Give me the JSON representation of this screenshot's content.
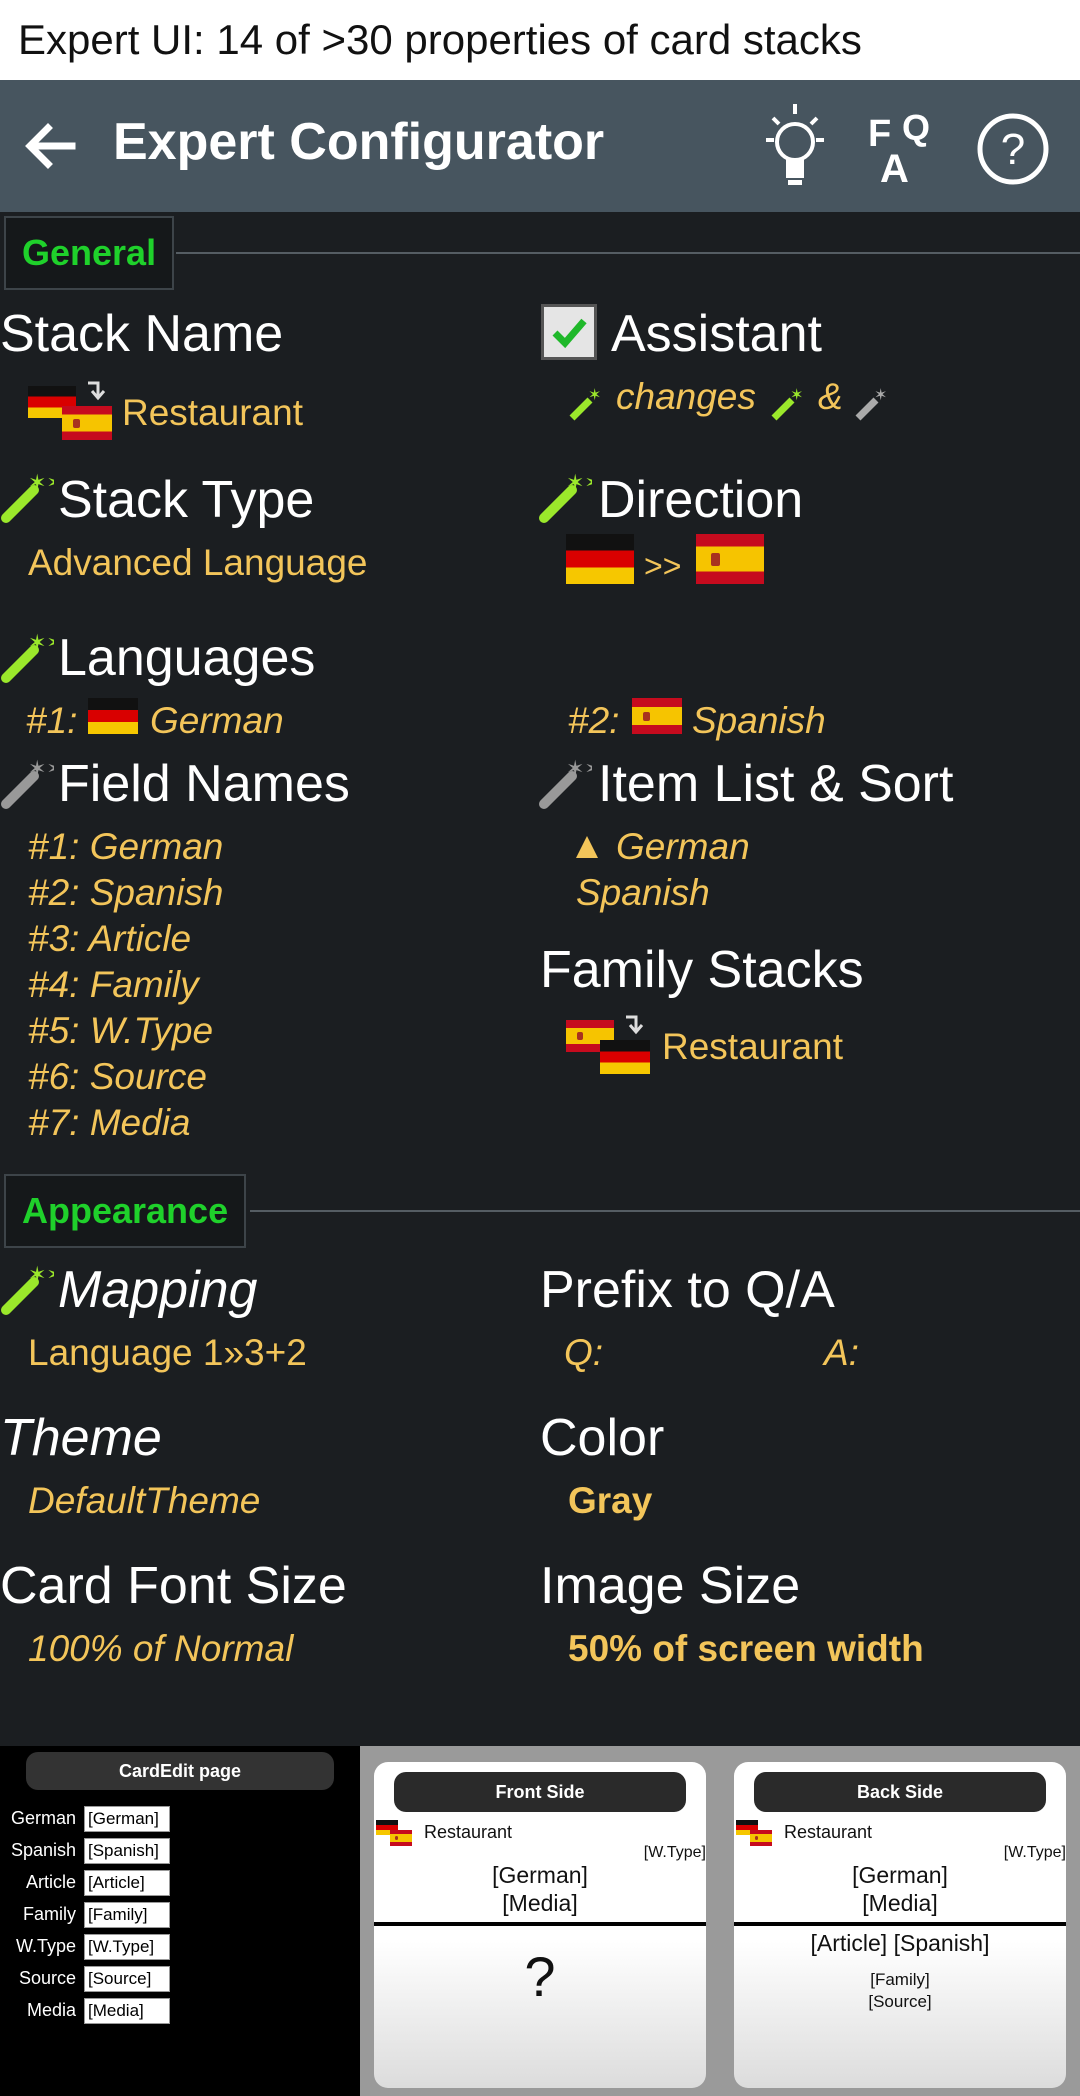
{
  "caption": "Expert UI: 14 of >30 properties of card stacks",
  "appbar": {
    "title": "Expert Configurator",
    "back_icon": "arrow-left-icon",
    "icons": [
      "lightbulb-icon",
      "faq-icon",
      "help-icon"
    ]
  },
  "general": {
    "header": "General",
    "stack_name": {
      "label": "Stack Name",
      "value": "Restaurant"
    },
    "assistant": {
      "label": "Assistant",
      "checked": true,
      "value_a": "changes",
      "value_b": "&"
    },
    "stack_type": {
      "label": "Stack Type",
      "value": "Advanced Language"
    },
    "direction": {
      "label": "Direction",
      "sep": ">>"
    },
    "languages": {
      "label": "Languages",
      "lang1_prefix": "#1:",
      "lang1": "German",
      "lang2_prefix": "#2:",
      "lang2": "Spanish"
    },
    "field_names": {
      "label": "Field Names",
      "items": [
        "#1: German",
        "#2: Spanish",
        "#3: Article",
        "#4: Family",
        "#5: W.Type",
        "#6: Source",
        "#7: Media"
      ]
    },
    "item_list": {
      "label": "Item List & Sort",
      "items": [
        "German",
        "Spanish"
      ]
    },
    "family_stacks": {
      "label": "Family Stacks",
      "value": "Restaurant"
    }
  },
  "appearance": {
    "header": "Appearance",
    "mapping": {
      "label": "Mapping",
      "value": "Language 1»3+2"
    },
    "prefix": {
      "label": "Prefix to Q/A",
      "q": "Q:",
      "a": "A:"
    },
    "theme": {
      "label": "Theme",
      "value": "DefaultTheme"
    },
    "color": {
      "label": "Color",
      "value": "Gray"
    },
    "font_size": {
      "label": "Card Font Size",
      "value": "100% of Normal"
    },
    "image_size": {
      "label": "Image Size",
      "value": "50% of screen width"
    }
  },
  "cardedit": {
    "title": "CardEdit page",
    "fields": [
      {
        "label": "German",
        "value": "[German]"
      },
      {
        "label": "Spanish",
        "value": "[Spanish]"
      },
      {
        "label": "Article",
        "value": "[Article]"
      },
      {
        "label": "Family",
        "value": "[Family]"
      },
      {
        "label": "W.Type",
        "value": "[W.Type]"
      },
      {
        "label": "Source",
        "value": "[Source]"
      },
      {
        "label": "Media",
        "value": "[Media]"
      }
    ]
  },
  "front": {
    "title": "Front Side",
    "stack": "Restaurant",
    "wtype": "[W.Type]",
    "line1": "[German]",
    "line2": "[Media]",
    "answer": "?"
  },
  "back": {
    "title": "Back Side",
    "stack": "Restaurant",
    "wtype": "[W.Type]",
    "line1": "[German]",
    "line2": "[Media]",
    "line3": "[Article] [Spanish]",
    "line4": "[Family]",
    "line5": "[Source]"
  },
  "colors": {
    "accent_green": "#1fd12b",
    "value_yellow": "#f3c55a",
    "appbar": "#47555f",
    "background": "#1b1e21"
  }
}
